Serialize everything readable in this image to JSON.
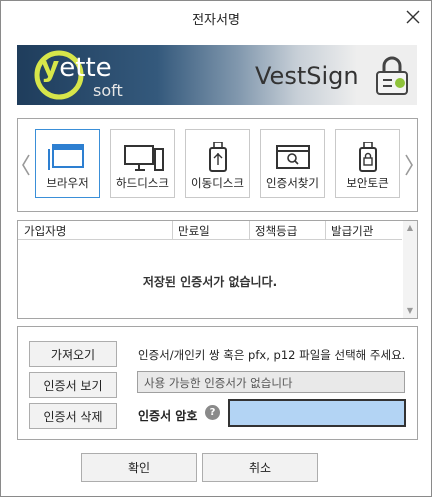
{
  "window": {
    "title": "전자서명",
    "close_icon": "close-icon"
  },
  "banner": {
    "logo_y": "y",
    "logo_rest": "ette",
    "logo_soft": "soft",
    "product": "VestSign",
    "colors": {
      "logo_accent": "#d7e64a",
      "lock_green": "#8fc33a"
    }
  },
  "media": {
    "selected": "browser",
    "items": [
      {
        "id": "browser",
        "label": "브라우저",
        "icon": "browser-window-icon"
      },
      {
        "id": "harddisk",
        "label": "하드디스크",
        "icon": "monitor-pc-icon"
      },
      {
        "id": "removable",
        "label": "이동디스크",
        "icon": "usb-drive-icon"
      },
      {
        "id": "find",
        "label": "인증서찾기",
        "icon": "search-window-icon"
      },
      {
        "id": "token",
        "label": "보안토큰",
        "icon": "security-token-icon"
      }
    ]
  },
  "cert_table": {
    "columns": [
      "가입자명",
      "만료일",
      "정책등급",
      "발급기관"
    ],
    "rows": [],
    "empty_message": "저장된 인증서가 없습니다."
  },
  "actions": {
    "import_label": "가져오기",
    "view_label": "인증서 보기",
    "delete_label": "인증서 삭제",
    "hint": "인증서/개인키 쌍 혹은 pfx, p12 파일을 선택해 주세요.",
    "selected_cert": "사용 가능한 인증서가 없습니다",
    "password_label": "인증서 암호",
    "help_glyph": "?",
    "password_value": ""
  },
  "footer": {
    "ok_label": "확인",
    "cancel_label": "취소"
  },
  "colors": {
    "selected_border": "#3a8fd8",
    "password_bg": "#b3d4f4"
  }
}
